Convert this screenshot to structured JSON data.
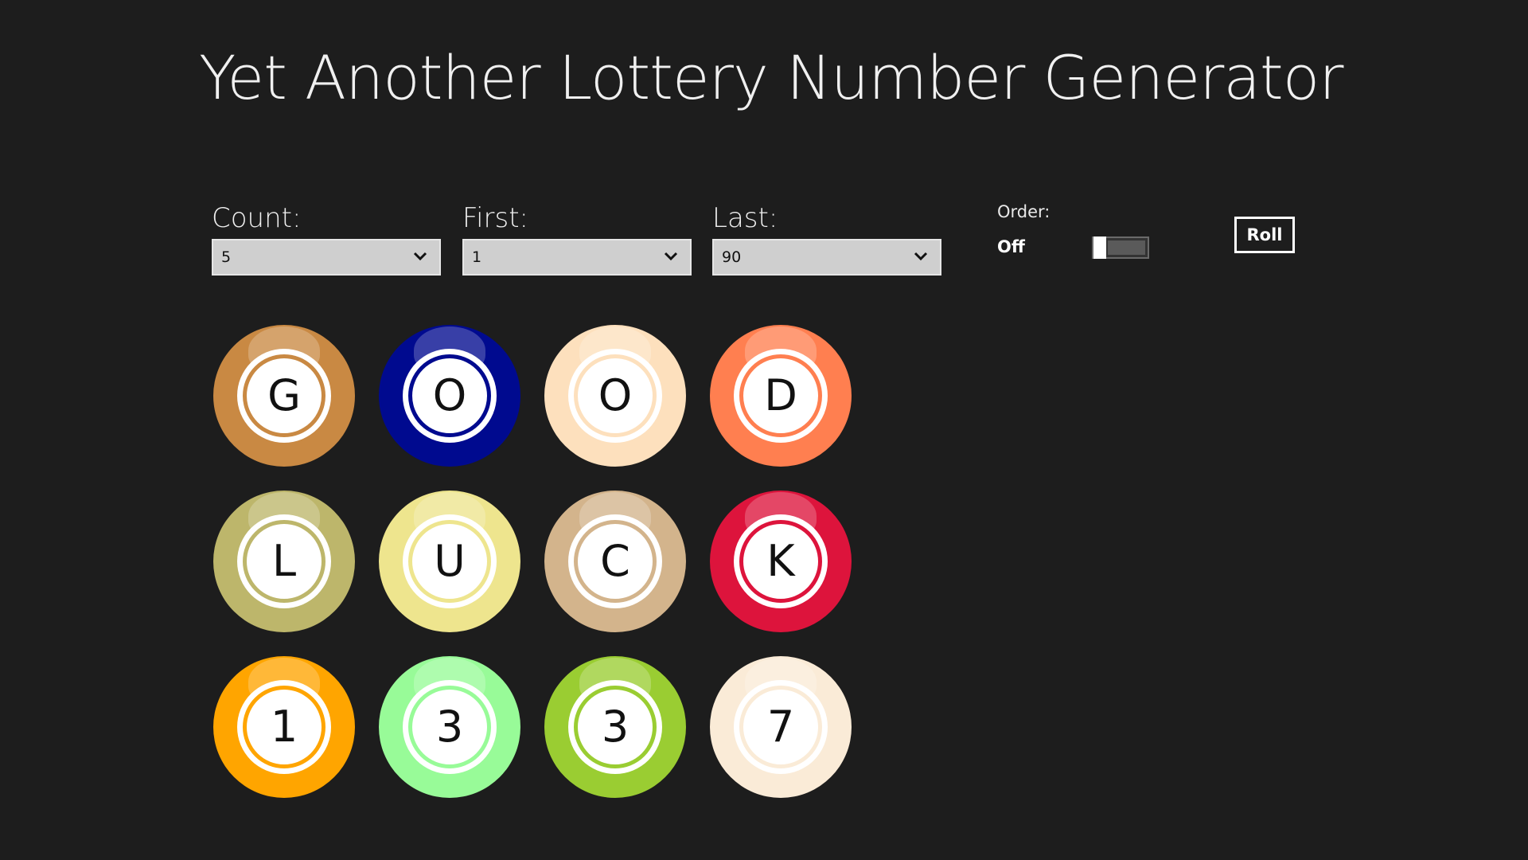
{
  "app": {
    "title": "Yet Another Lottery Number Generator"
  },
  "controls": {
    "count": {
      "label": "Count:",
      "value": "5"
    },
    "first": {
      "label": "First:",
      "value": "1"
    },
    "last": {
      "label": "Last:",
      "value": "90"
    },
    "order": {
      "label": "Order:",
      "state": "Off"
    },
    "roll_label": "Roll"
  },
  "balls": [
    {
      "glyph": "G",
      "color": "#c98943"
    },
    {
      "glyph": "O",
      "color": "#000a8f"
    },
    {
      "glyph": "O",
      "color": "#fde0bd"
    },
    {
      "glyph": "D",
      "color": "#ff7f50"
    },
    {
      "glyph": "L",
      "color": "#bdb66b"
    },
    {
      "glyph": "U",
      "color": "#eee58e"
    },
    {
      "glyph": "C",
      "color": "#d3b48c"
    },
    {
      "glyph": "K",
      "color": "#dd143c"
    },
    {
      "glyph": "1",
      "color": "#ffa500"
    },
    {
      "glyph": "3",
      "color": "#98fb98"
    },
    {
      "glyph": "3",
      "color": "#9acd32"
    },
    {
      "glyph": "7",
      "color": "#faebd7"
    }
  ]
}
